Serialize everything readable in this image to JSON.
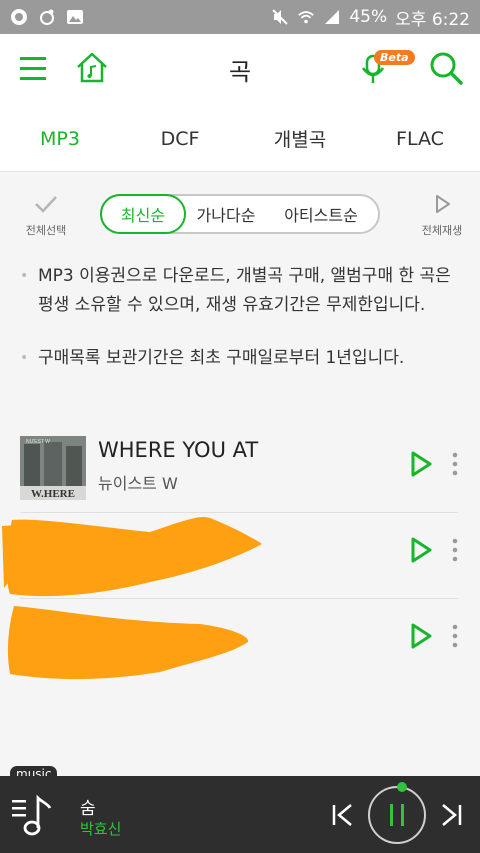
{
  "status_bar": {
    "battery": "45%",
    "time": "오후 6:22"
  },
  "header": {
    "title": "곡",
    "beta_badge": "Beta"
  },
  "format_tabs": [
    "MP3",
    "DCF",
    "개별곡",
    "FLAC"
  ],
  "sort": {
    "select_all_label": "전체선택",
    "options": [
      "최신순",
      "가나다순",
      "아티스트순"
    ],
    "active_option": "최신순",
    "play_all_label": "전체재생"
  },
  "notices": [
    "MP3 이용권으로 다운로드, 개별곡 구매, 앨범구매 한 곡은 평생 소유할 수 있으며, 재생 유효기간은 무제한입니다.",
    "구매목록 보관기간은 최초 구매일로부터 1년입니다."
  ],
  "songs": [
    {
      "title": "WHERE YOU AT",
      "artist": "뉴이스트 W",
      "album_art_text": "W.HERE",
      "album_art_top_text": "NU'EST W"
    },
    {
      "title": "",
      "artist": ""
    },
    {
      "title": "",
      "artist": ""
    }
  ],
  "player": {
    "tag": "music",
    "title": "숨",
    "artist": "박효신"
  },
  "colors": {
    "accent": "#17b52a",
    "status_bar": "#9a9a9a",
    "player_bg": "#2e2e2e",
    "redaction": "#ff9f12",
    "beta": "#f47b20"
  },
  "icons": {
    "menu": "hamburger-icon",
    "home": "home-music-icon",
    "mic": "mic-icon",
    "search": "search-icon",
    "check": "check-icon",
    "play": "play-icon",
    "more": "more-vertical-icon",
    "playlist": "playlist-icon",
    "prev": "skip-previous-icon",
    "pause": "pause-icon",
    "next": "skip-next-icon"
  }
}
